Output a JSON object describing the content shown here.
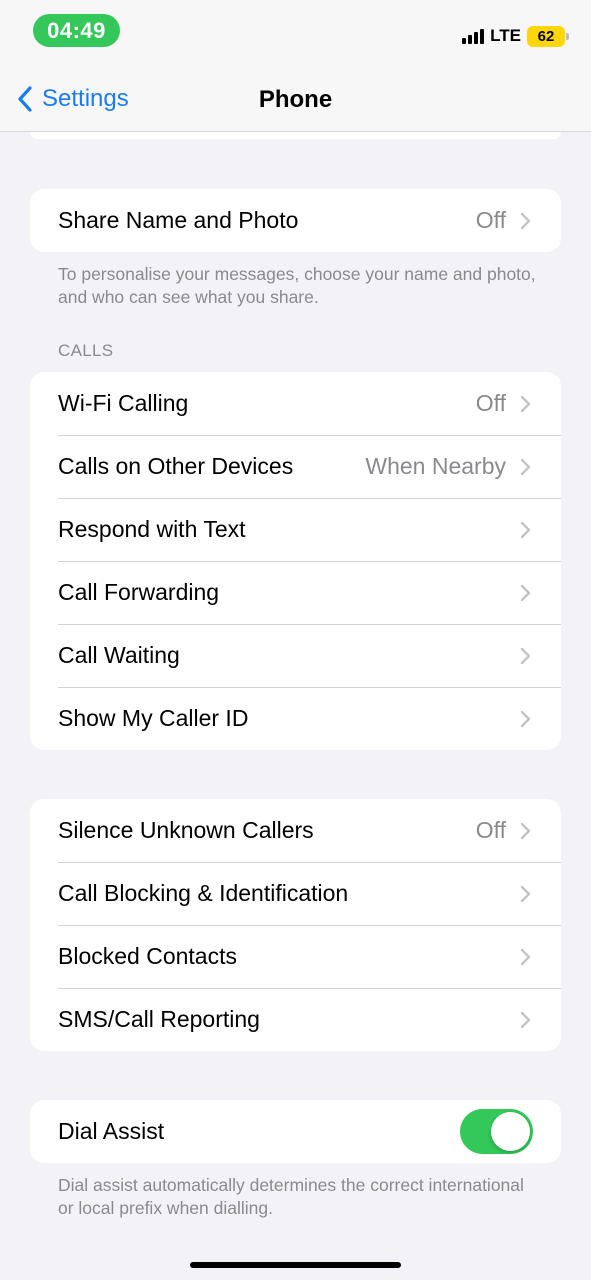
{
  "status_bar": {
    "time": "04:49",
    "network": "LTE",
    "battery": "62",
    "colors": {
      "time_pill": "#34c759",
      "battery": "#ffd60a"
    }
  },
  "navbar": {
    "back_label": "Settings",
    "title": "Phone",
    "icons": {
      "back": "chevron-left-icon"
    }
  },
  "share_section": {
    "row": {
      "label": "Share Name and Photo",
      "value": "Off"
    },
    "footer": "To personalise your messages, choose your name and photo, and who can see what you share."
  },
  "calls_section": {
    "header": "CALLS",
    "rows": [
      {
        "label": "Wi-Fi Calling",
        "value": "Off"
      },
      {
        "label": "Calls on Other Devices",
        "value": "When Nearby"
      },
      {
        "label": "Respond with Text",
        "value": ""
      },
      {
        "label": "Call Forwarding",
        "value": ""
      },
      {
        "label": "Call Waiting",
        "value": ""
      },
      {
        "label": "Show My Caller ID",
        "value": ""
      }
    ]
  },
  "blocking_section": {
    "rows": [
      {
        "label": "Silence Unknown Callers",
        "value": "Off"
      },
      {
        "label": "Call Blocking & Identification",
        "value": ""
      },
      {
        "label": "Blocked Contacts",
        "value": ""
      },
      {
        "label": "SMS/Call Reporting",
        "value": ""
      }
    ]
  },
  "dial_assist_section": {
    "label": "Dial Assist",
    "enabled": true,
    "footer": "Dial assist automatically determines the correct international or local prefix when dialling."
  },
  "colors": {
    "accent": "#1a7cf5",
    "toggle_on": "#34c759",
    "background": "#f2f2f7"
  }
}
